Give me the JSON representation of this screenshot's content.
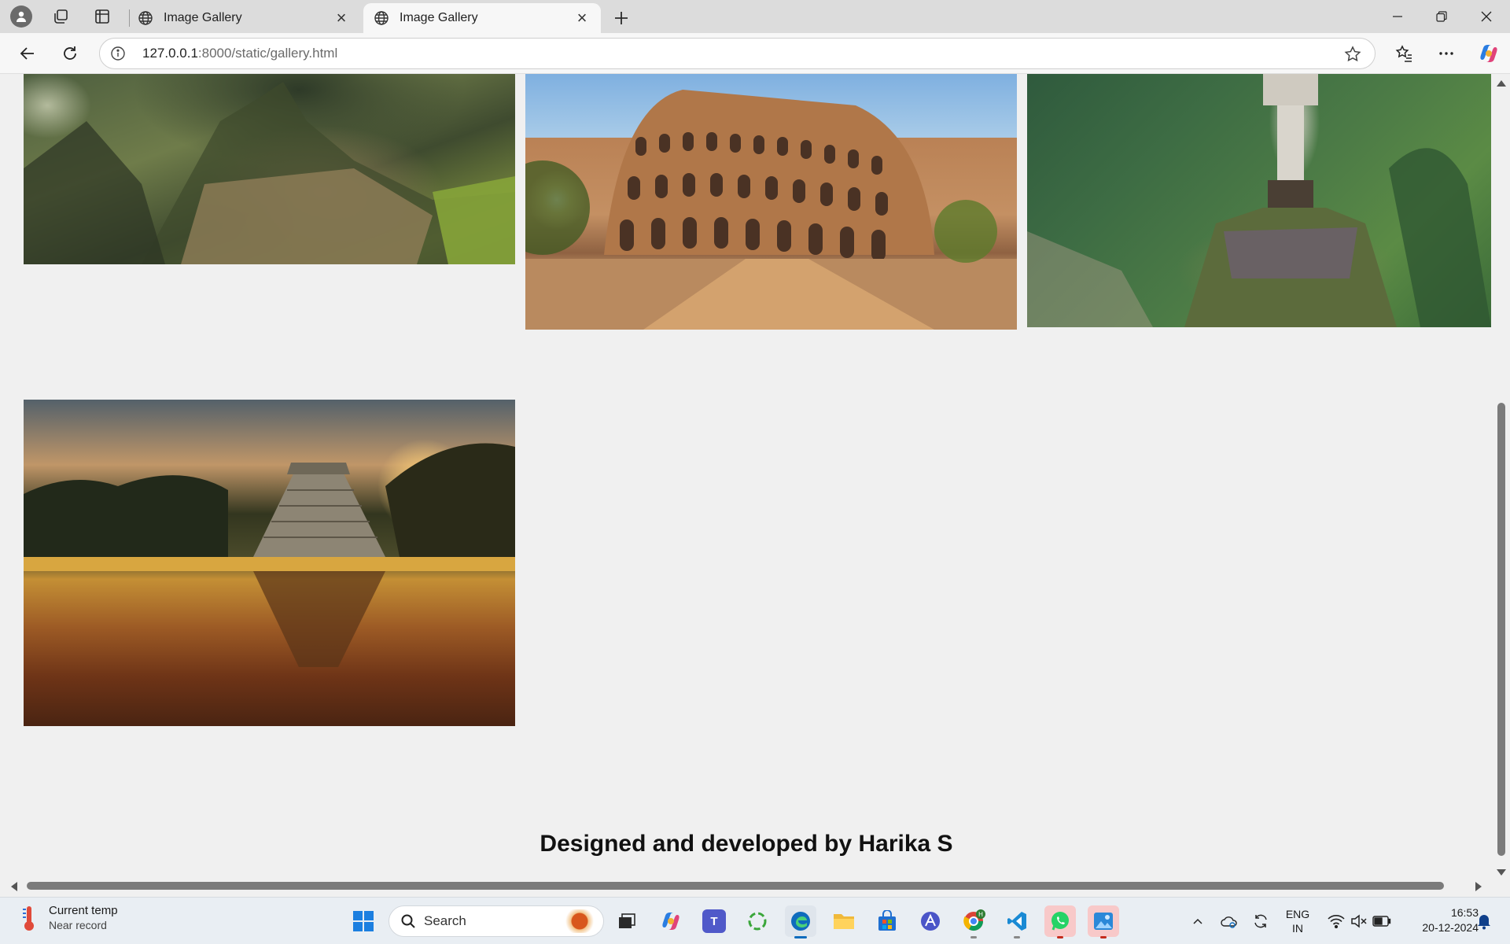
{
  "browser": {
    "tabs": [
      {
        "title": "Image Gallery",
        "active": false
      },
      {
        "title": "Image Gallery",
        "active": true
      }
    ],
    "url_host": "127.0.0.1",
    "url_rest": ":8000/static/gallery.html"
  },
  "page": {
    "credit": "Designed and developed by Harika S",
    "images": [
      {
        "name": "machu-picchu-image",
        "subject": "Machu Picchu"
      },
      {
        "name": "colosseum-image",
        "subject": "Colosseum"
      },
      {
        "name": "christ-the-redeemer-image",
        "subject": "Christ the Redeemer"
      },
      {
        "name": "chichen-itza-image",
        "subject": "Chichen Itza"
      }
    ]
  },
  "taskbar": {
    "weather_title": "Current temp",
    "weather_subtitle": "Near record",
    "search_label": "Search",
    "lang_top": "ENG",
    "lang_bottom": "IN",
    "time": "16:53",
    "date": "20-12-2024"
  },
  "colors": {
    "page_bg": "#f0f0f0",
    "tab_strip": "#dcdcdc",
    "taskbar_bg": "#e9eef3",
    "edge_blue": "#0f6cbd"
  }
}
